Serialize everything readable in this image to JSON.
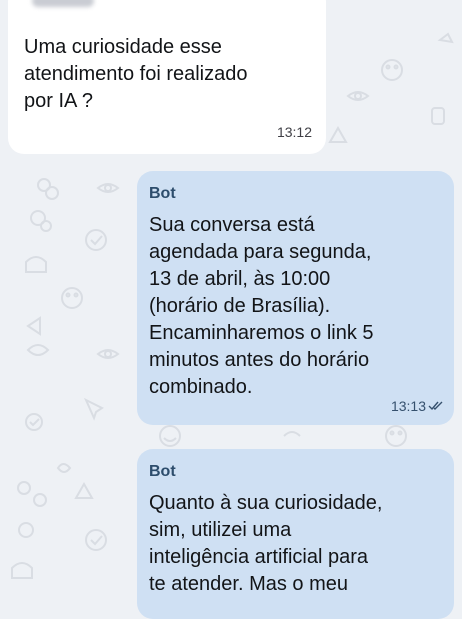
{
  "chat": {
    "messages": [
      {
        "direction": "incoming",
        "text": "Uma curiosidade esse\natendimento foi realizado\npor IA ?",
        "time": "13:12"
      },
      {
        "direction": "outgoing",
        "sender": "Bot",
        "text": "Sua conversa está\nagendada para segunda,\n13 de abril, às 10:00\n(horário de Brasília).\nEncaminharemos o link 5\nminutos antes do horário\ncombinado.",
        "time": "13:13",
        "status_icon": "double-check-icon"
      },
      {
        "direction": "outgoing",
        "sender": "Bot",
        "text": "Quanto à sua curiosidade,\nsim, utilizei uma\ninteligência artificial para\nte atender. Mas o meu",
        "time": ""
      }
    ]
  },
  "colors": {
    "background": "#eef1f5",
    "incoming_bubble": "#ffffff",
    "outgoing_bubble": "#cfe0f3",
    "sender_name": "#2d4d6c"
  }
}
